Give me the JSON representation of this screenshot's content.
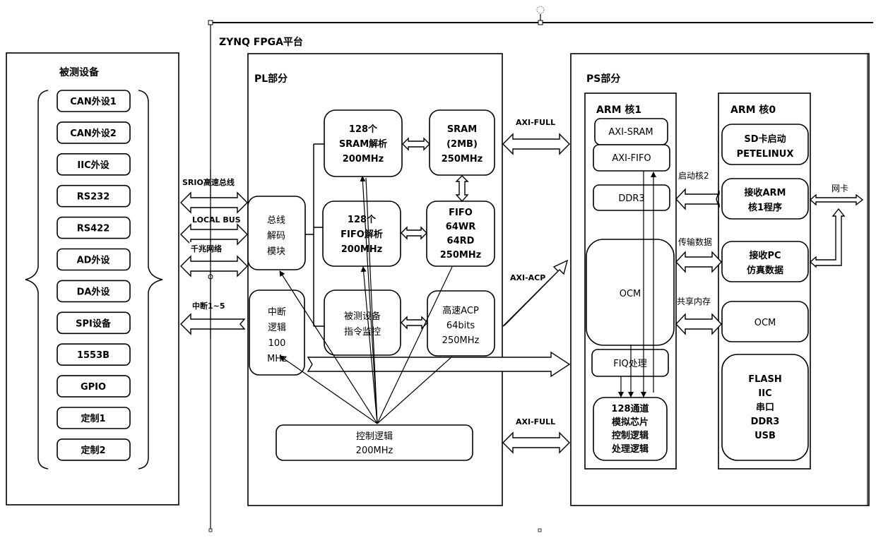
{
  "platform": {
    "title": "ZYNQ FPGA平台"
  },
  "dut": {
    "title": "被测设备",
    "items": [
      "CAN外设1",
      "CAN外设2",
      "IIC外设",
      "RS232",
      "RS422",
      "AD外设",
      "DA外设",
      "SPI设备",
      "1553B",
      "GPIO",
      "定制1",
      "定制2"
    ]
  },
  "links_left": {
    "srio": "SRIO高速总线",
    "localbus": "LOCAL BUS",
    "gige": "千兆网络",
    "irq": "中断1~5"
  },
  "pl": {
    "title": "PL部分",
    "bus_decoder": [
      "总线",
      "解码",
      "模块"
    ],
    "irq_logic": [
      "中断",
      "逻辑",
      "100",
      "MHz"
    ],
    "sram_parse": [
      "128个",
      "SRAM解析",
      "200MHz"
    ],
    "fifo_parse": [
      "128个",
      "FIFO解析",
      "200MHz"
    ],
    "dut_monitor": [
      "被测设备",
      "指令监控"
    ],
    "sram": [
      "SRAM",
      "(2MB)",
      "250MHz"
    ],
    "fifo": [
      "FIFO",
      "64WR",
      "64RD",
      "250MHz"
    ],
    "acp": [
      "高速ACP",
      "64bits",
      "250MHz"
    ],
    "control": [
      "控制逻辑",
      "200MHz"
    ]
  },
  "links_mid": {
    "axi_full_top": "AXI-FULL",
    "axi_acp": "AXI-ACP",
    "axi_full_bottom": "AXI-FULL"
  },
  "ps": {
    "title": "PS部分",
    "arm1": {
      "title": "ARM 核1",
      "axi_sram": "AXI-SRAM",
      "axi_fifo": "AXI-FIFO",
      "ddr3": "DDR3",
      "ocm": "OCM",
      "fiq": "FIQ处理",
      "analog": [
        "128通道",
        "模拟芯片",
        "控制逻辑",
        "处理逻辑"
      ]
    },
    "arm0": {
      "title": "ARM 核0",
      "sd_boot": [
        "SD卡启动",
        "PETELINUX"
      ],
      "recv_arm": [
        "接收ARM",
        "核1程序"
      ],
      "recv_pc": [
        "接收PC",
        "仿真数据"
      ],
      "ocm": "OCM",
      "periph": [
        "FLASH",
        "IIC",
        "串口",
        "DDR3",
        "USB"
      ]
    },
    "links": {
      "boot_core": "启动核2",
      "transfer": "传输数据",
      "shared_mem": "共享内存",
      "nic": "网卡"
    }
  }
}
